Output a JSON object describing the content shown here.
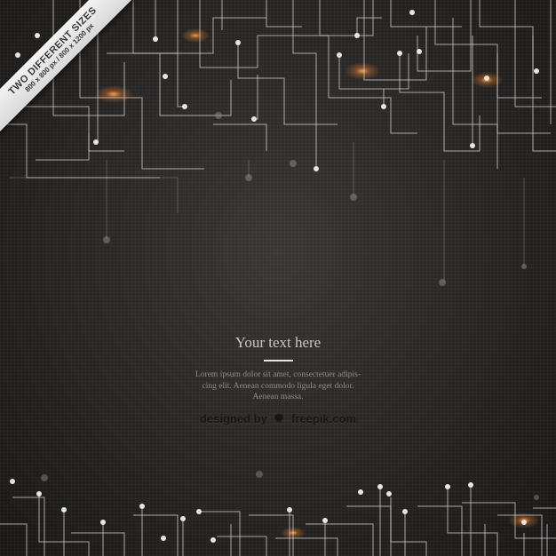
{
  "ribbon": {
    "line1": "TWO DIFFERENT SIZES",
    "line2": "800 x 800 px / 800 x 1200 px"
  },
  "title": "Your text here",
  "body": {
    "line1": "Lorem ipsum dolor sit amet, consectetuer adipis-",
    "line2": "cing elit. Aenean commodo ligula eget dolor.",
    "line3": "Aenean massa."
  },
  "credit": {
    "prefix": "designed by",
    "brand": "freepik.com"
  },
  "colors": {
    "background": "#2b2927",
    "line": "#d8d2cc",
    "glow": "#ff9a3c"
  }
}
